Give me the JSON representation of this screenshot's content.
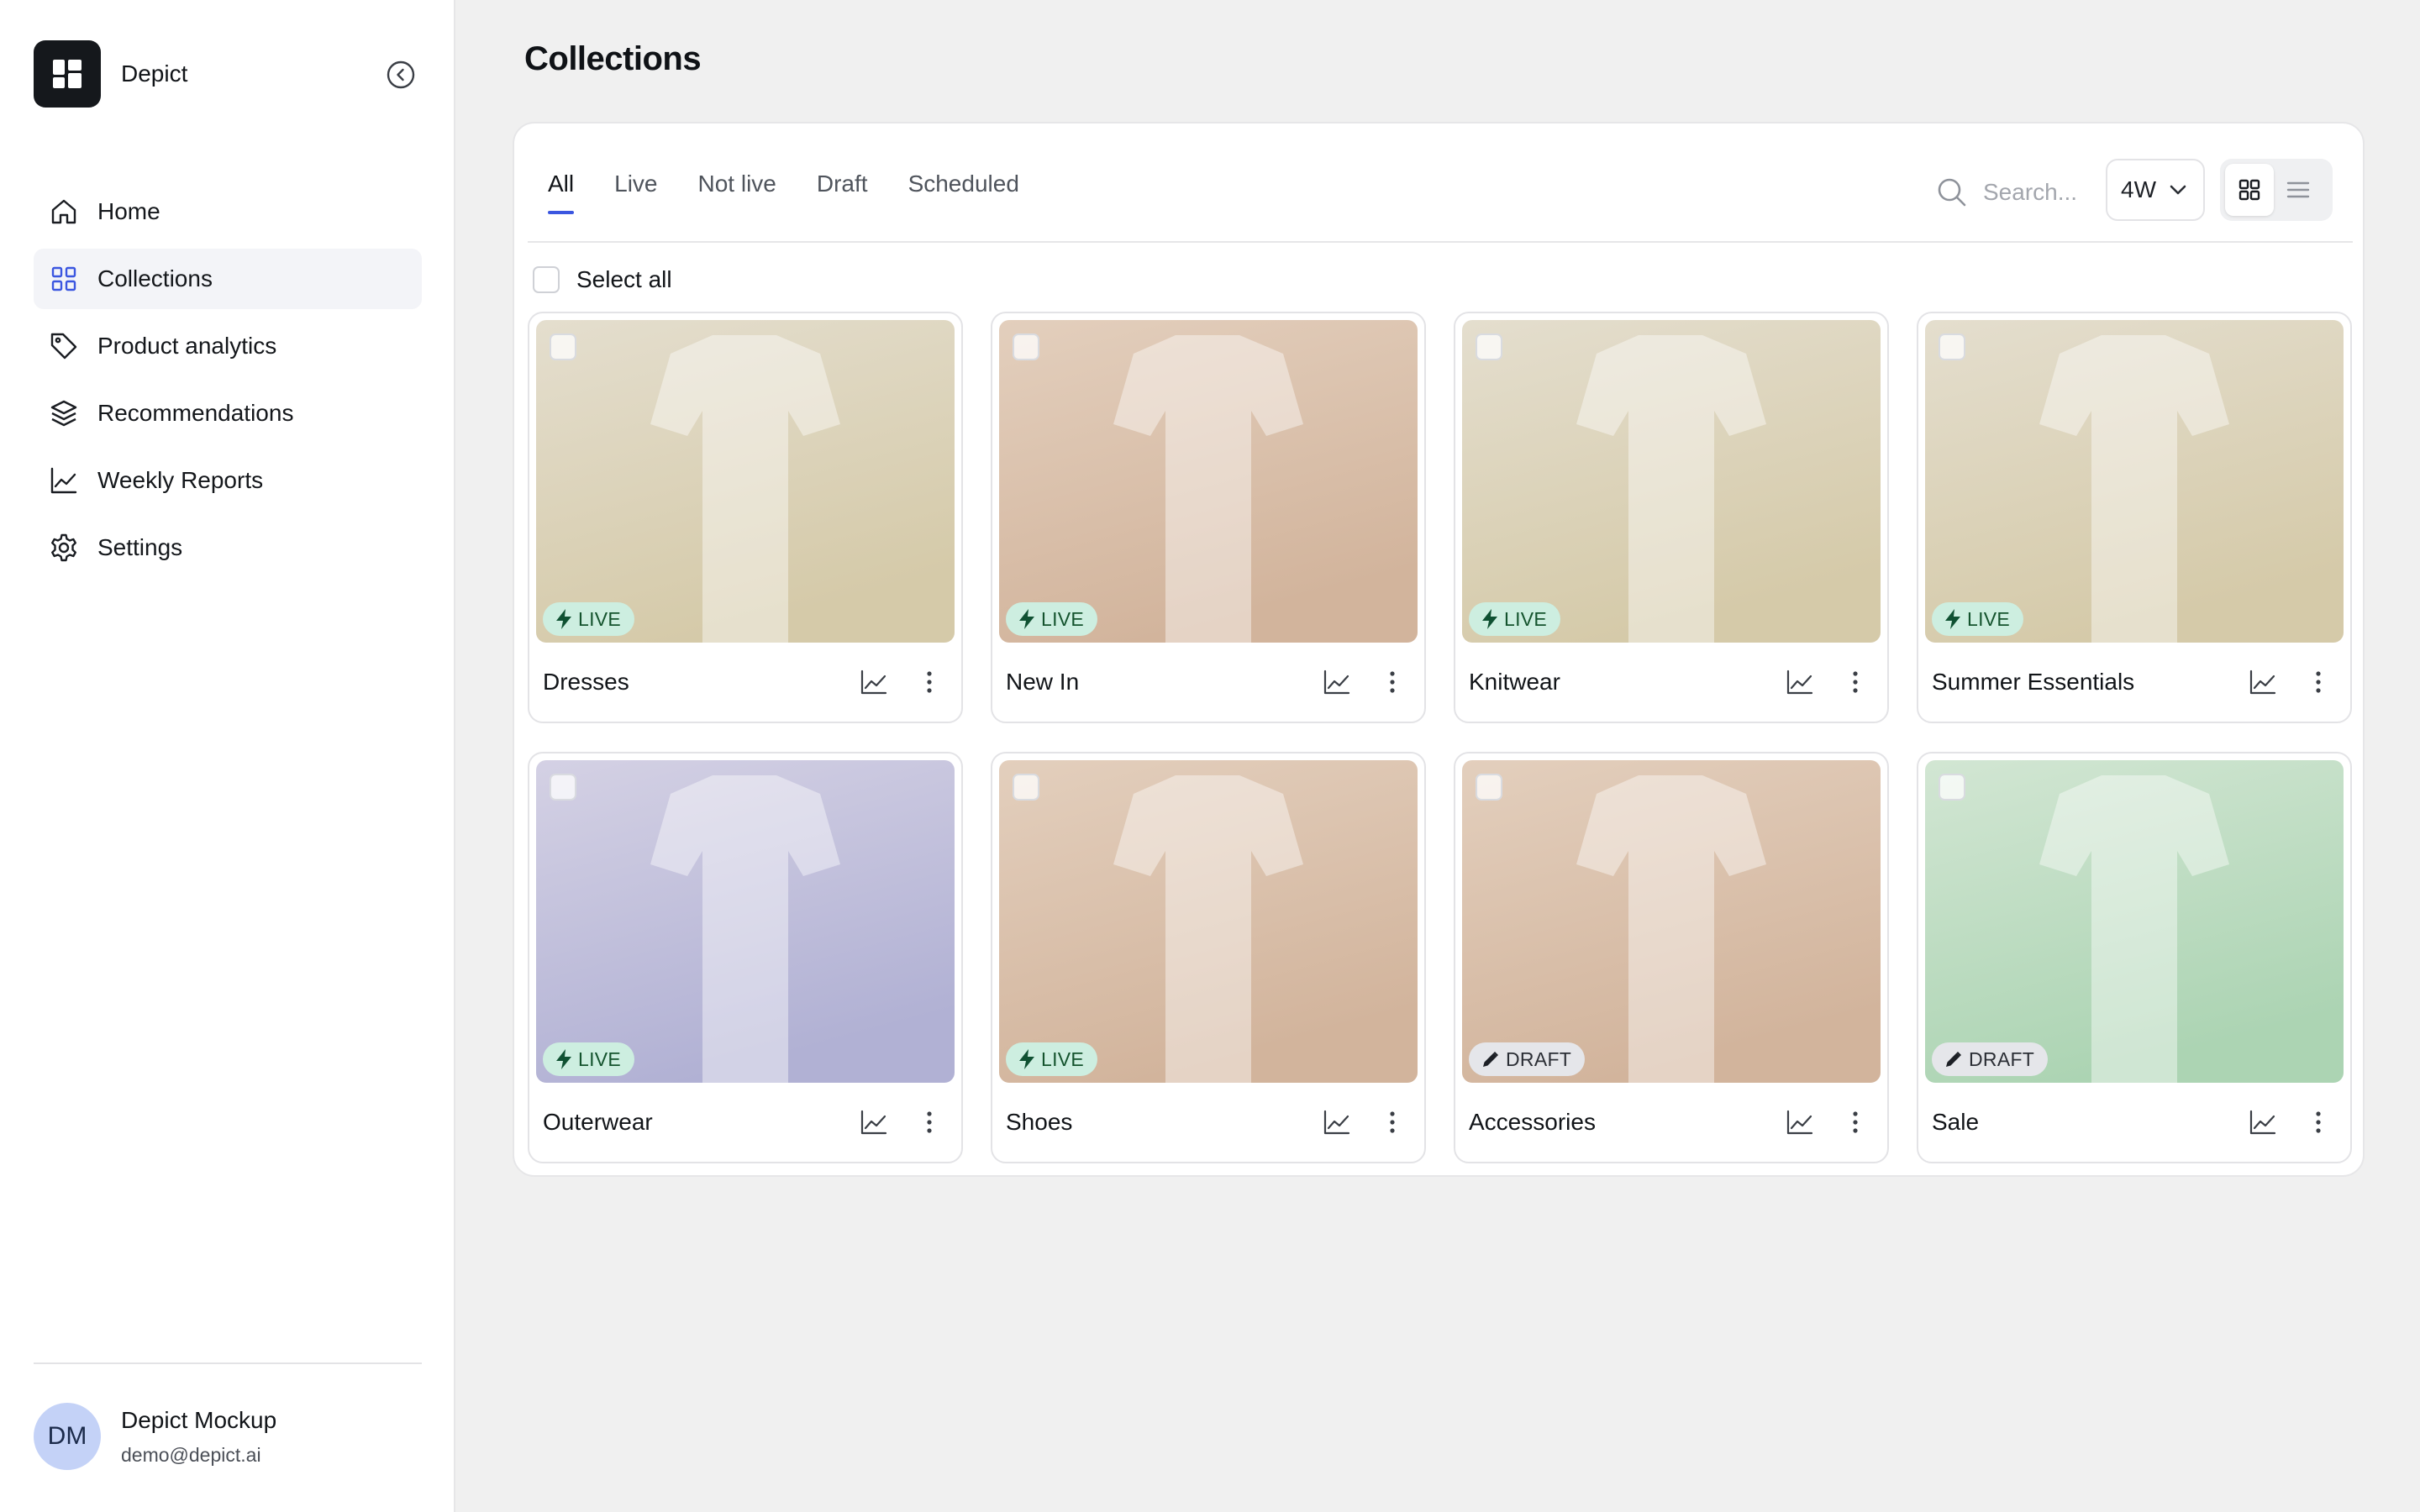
{
  "app": {
    "name": "Depict"
  },
  "sidebar": {
    "items": [
      {
        "label": "Home",
        "icon": "home-icon",
        "active": false
      },
      {
        "label": "Collections",
        "icon": "grid-icon",
        "active": true
      },
      {
        "label": "Product analytics",
        "icon": "tag-icon",
        "active": false
      },
      {
        "label": "Recommendations",
        "icon": "layers-icon",
        "active": false
      },
      {
        "label": "Weekly Reports",
        "icon": "chart-line-icon",
        "active": false
      },
      {
        "label": "Settings",
        "icon": "gear-icon",
        "active": false
      }
    ],
    "user": {
      "initials": "DM",
      "name": "Depict Mockup",
      "email": "demo@depict.ai"
    }
  },
  "main": {
    "title": "Collections",
    "tabs": [
      {
        "label": "All",
        "active": true
      },
      {
        "label": "Live",
        "active": false
      },
      {
        "label": "Not live",
        "active": false
      },
      {
        "label": "Draft",
        "active": false
      },
      {
        "label": "Scheduled",
        "active": false
      }
    ],
    "search": {
      "placeholder": "Search..."
    },
    "period": "4W",
    "select_all_label": "Select all",
    "collections": [
      {
        "name": "Dresses",
        "status": "LIVE",
        "color_top": "#e4dece",
        "color_bottom": "#d5caa9"
      },
      {
        "name": "New In",
        "status": "LIVE",
        "color_top": "#e3cfbd",
        "color_bottom": "#d2b49c"
      },
      {
        "name": "Knitwear",
        "status": "LIVE",
        "color_top": "#e4dece",
        "color_bottom": "#d5caa9"
      },
      {
        "name": "Summer Essentials",
        "status": "LIVE",
        "color_top": "#e4dece",
        "color_bottom": "#d5caa9"
      },
      {
        "name": "Outerwear",
        "status": "LIVE",
        "color_top": "#d4d1e4",
        "color_bottom": "#b1b1d4"
      },
      {
        "name": "Shoes",
        "status": "LIVE",
        "color_top": "#e3cfbd",
        "color_bottom": "#d2b49c"
      },
      {
        "name": "Accessories",
        "status": "DRAFT",
        "color_top": "#e3cfbd",
        "color_bottom": "#d2b49c"
      },
      {
        "name": "Sale",
        "status": "DRAFT",
        "color_top": "#d2e6d3",
        "color_bottom": "#acd4b3"
      }
    ]
  },
  "colors": {
    "accent": "#3b56e0",
    "live_badge_bg": "#cdeee0",
    "draft_badge_bg": "#e5e6ea",
    "sidebar_active_bg": "#f3f4f8"
  }
}
